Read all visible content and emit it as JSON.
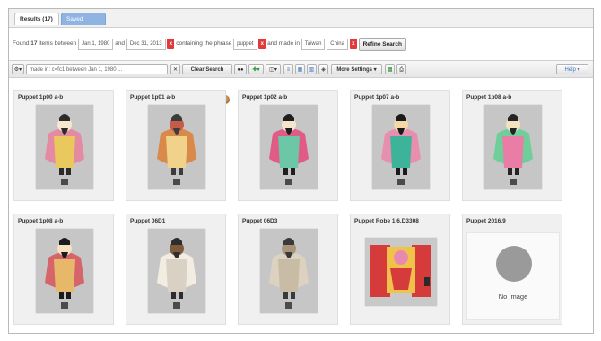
{
  "tabs": {
    "results_label": "Results (17)",
    "second_label": "Saved"
  },
  "summary": {
    "found_prefix": "Found",
    "count": "17",
    "items_between": "items between",
    "date_from": "Jan 1, 1980",
    "and": "and",
    "date_to": "Dec 31, 2013",
    "containing": "containing the phrase",
    "phrase": "puppet",
    "made_in": "and made in",
    "place_1": "Taiwan",
    "place_2": "China",
    "refine_label": "Refine Search"
  },
  "toolbar": {
    "query_text": "made in: c=fc1 between Jan 1, 1980 ...",
    "clear_label": "Clear Search",
    "more_settings_label": "More Settings ▾",
    "help_label": "Help ▾"
  },
  "cards": [
    {
      "title": "Puppet 1p00 a-b",
      "palette": [
        "#e58aa3",
        "#e9c85d",
        "#f5e9cf",
        "#2b2b2b"
      ]
    },
    {
      "title": "Puppet 1p01 a-b",
      "palette": [
        "#d98a4a",
        "#f0d28a",
        "#c55c4a",
        "#3c3c3c"
      ]
    },
    {
      "title": "Puppet 1p02 a-b",
      "palette": [
        "#e05c86",
        "#6bc7a5",
        "#f4e6cd",
        "#1f1f1f"
      ]
    },
    {
      "title": "Puppet 1p07 a-b",
      "palette": [
        "#e88fb0",
        "#3db39a",
        "#f6d8a5",
        "#1a1a1a"
      ]
    },
    {
      "title": "Puppet 1p08 a-b",
      "palette": [
        "#6fcf9b",
        "#e97da6",
        "#f3e2c0",
        "#242424"
      ]
    },
    {
      "title": "Puppet 1p08 a-b",
      "palette": [
        "#d5656a",
        "#e8b86a",
        "#f6e1c0",
        "#1c1c1c"
      ]
    },
    {
      "title": "Puppet 06D1",
      "palette": [
        "#f2ece2",
        "#d9d1c4",
        "#7c5a3a",
        "#2d2d2d"
      ]
    },
    {
      "title": "Puppet 06D3",
      "palette": [
        "#ddd2c0",
        "#c9bca6",
        "#a9937a",
        "#3a3a3a"
      ]
    },
    {
      "title": "Puppet Robe 1.6.D3308",
      "palette": [
        "#d63b3b",
        "#f0c24a",
        "#e88ab0",
        "#2a2a2a"
      ]
    },
    {
      "title": "Puppet 2016.9",
      "no_image": "No Image"
    }
  ]
}
